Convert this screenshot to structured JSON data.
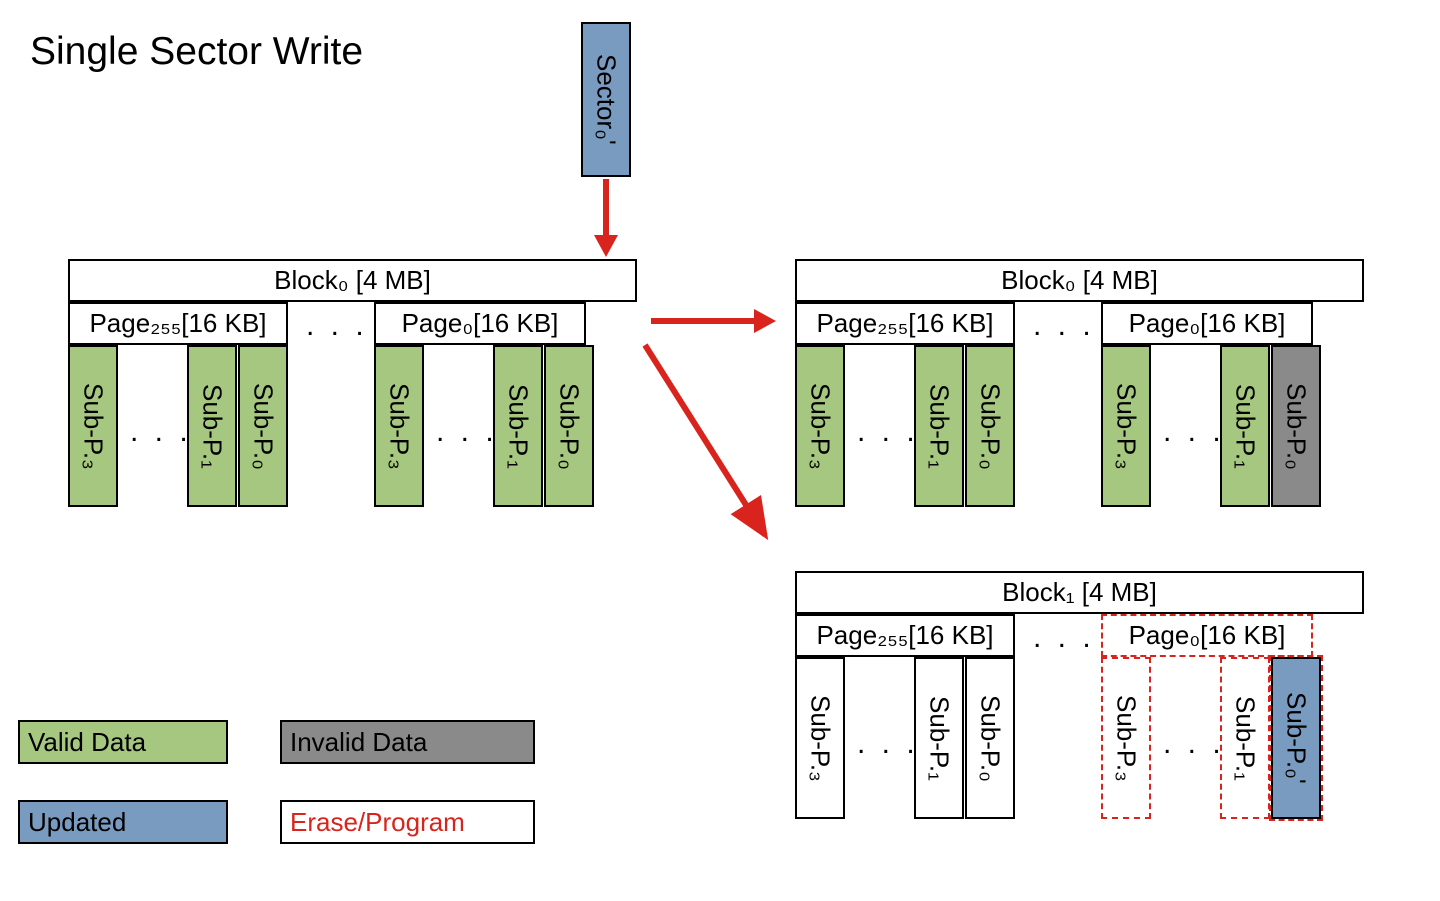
{
  "title": "Single Sector Write",
  "sector": "Sector₀'",
  "leftBlock": {
    "header": "Block₀ [4 MB]",
    "page255": "Page₂₅₅[16 KB]",
    "page0": "Page₀[16 KB]",
    "sp255": {
      "sp3": "Sub-P.₃",
      "sp1": "Sub-P.₁",
      "sp0": "Sub-P.₀"
    },
    "sp0": {
      "sp3": "Sub-P.₃",
      "sp1": "Sub-P.₁",
      "sp0": "Sub-P.₀"
    }
  },
  "rightBlock0": {
    "header": "Block₀ [4 MB]",
    "page255": "Page₂₅₅[16 KB]",
    "page0": "Page₀[16 KB]",
    "sp255": {
      "sp3": "Sub-P.₃",
      "sp1": "Sub-P.₁",
      "sp0": "Sub-P.₀"
    },
    "sp0": {
      "sp3": "Sub-P.₃",
      "sp1": "Sub-P.₁",
      "sp0": "Sub-P.₀"
    }
  },
  "rightBlock1": {
    "header": "Block₁ [4 MB]",
    "page255": "Page₂₅₅[16 KB]",
    "page0": "Page₀[16 KB]",
    "sp255": {
      "sp3": "Sub-P.₃",
      "sp1": "Sub-P.₁",
      "sp0": "Sub-P.₀"
    },
    "sp0": {
      "sp3": "Sub-P.₃",
      "sp1": "Sub-P.₁",
      "sp0": "Sub-P.₀'"
    }
  },
  "legend": {
    "valid": "Valid Data",
    "invalid": "Invalid Data",
    "updated": "Updated",
    "erase": "Erase/Program"
  },
  "colors": {
    "green": "#a5c77f",
    "gray": "#8a8a8a",
    "blue": "#799bbf",
    "red": "#d9241d"
  },
  "ellipsis": ". . ."
}
